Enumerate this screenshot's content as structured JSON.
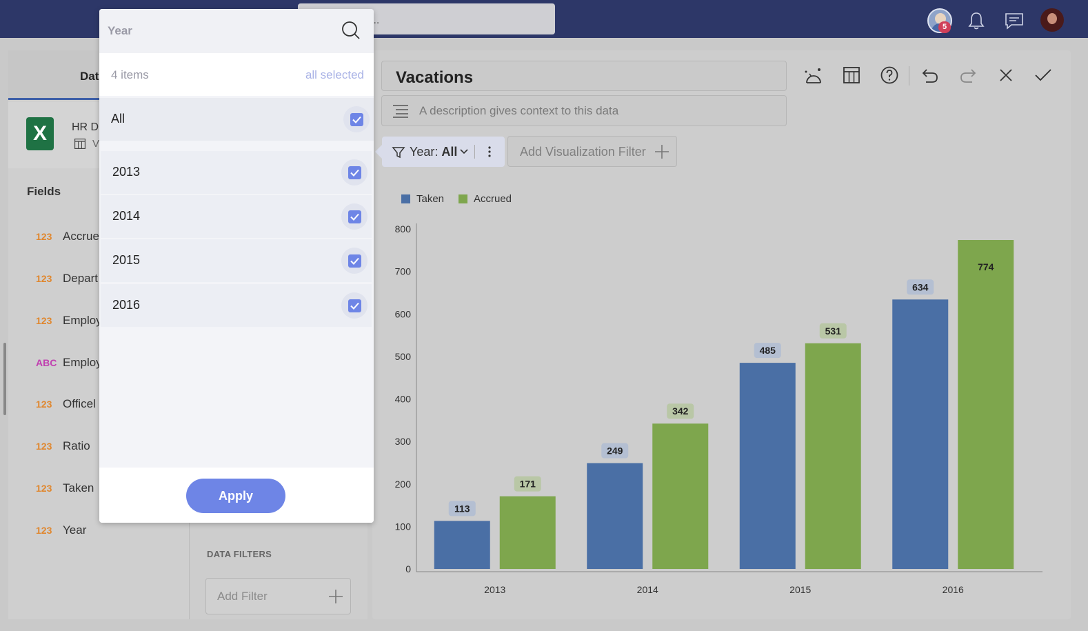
{
  "topbar": {
    "search_text": "...",
    "notification_count": "5"
  },
  "left_panel": {
    "tab_label": "Dat",
    "datasource_name": "HR D",
    "datasource_sub": "V",
    "fields_title": "Fields",
    "fields": [
      {
        "type": "123",
        "label": "Accrue"
      },
      {
        "type": "123",
        "label": "Depart"
      },
      {
        "type": "123",
        "label": "Employ"
      },
      {
        "type": "ABC",
        "label": "Employ"
      },
      {
        "type": "123",
        "label": "Officel"
      },
      {
        "type": "123",
        "label": "Ratio"
      },
      {
        "type": "123",
        "label": "Taken"
      },
      {
        "type": "123",
        "label": "Year"
      }
    ]
  },
  "mid_panel": {
    "data_filters_title": "DATA FILTERS",
    "add_filter_label": "Add Filter"
  },
  "viz": {
    "title": "Vacations",
    "description_placeholder": "A description gives context to this data",
    "year_filter_label": "Year:",
    "year_filter_value": "All",
    "add_viz_filter_label": "Add Visualization Filter"
  },
  "dropdown": {
    "search_placeholder": "Year",
    "count_text": "4 items",
    "all_selected_text": "all selected",
    "items": [
      {
        "label": "All",
        "checked": true
      },
      {
        "label": "2013",
        "checked": true
      },
      {
        "label": "2014",
        "checked": true
      },
      {
        "label": "2015",
        "checked": true
      },
      {
        "label": "2016",
        "checked": true
      }
    ],
    "apply_label": "Apply"
  },
  "colors": {
    "taken": "#4a6fa5",
    "accrued": "#7ea64d",
    "accent": "#6e85e6",
    "topbar": "#2d3768"
  },
  "chart_data": {
    "type": "bar",
    "title": "",
    "categories": [
      "2013",
      "2014",
      "2015",
      "2016"
    ],
    "series": [
      {
        "name": "Taken",
        "values": [
          113,
          249,
          485,
          634
        ]
      },
      {
        "name": "Accrued",
        "values": [
          171,
          342,
          531,
          774
        ]
      }
    ],
    "ylim": [
      0,
      800
    ],
    "yticks": [
      0,
      100,
      200,
      300,
      400,
      500,
      600,
      700,
      800
    ],
    "legend": "top-left",
    "grid": false,
    "data_labels": true
  }
}
